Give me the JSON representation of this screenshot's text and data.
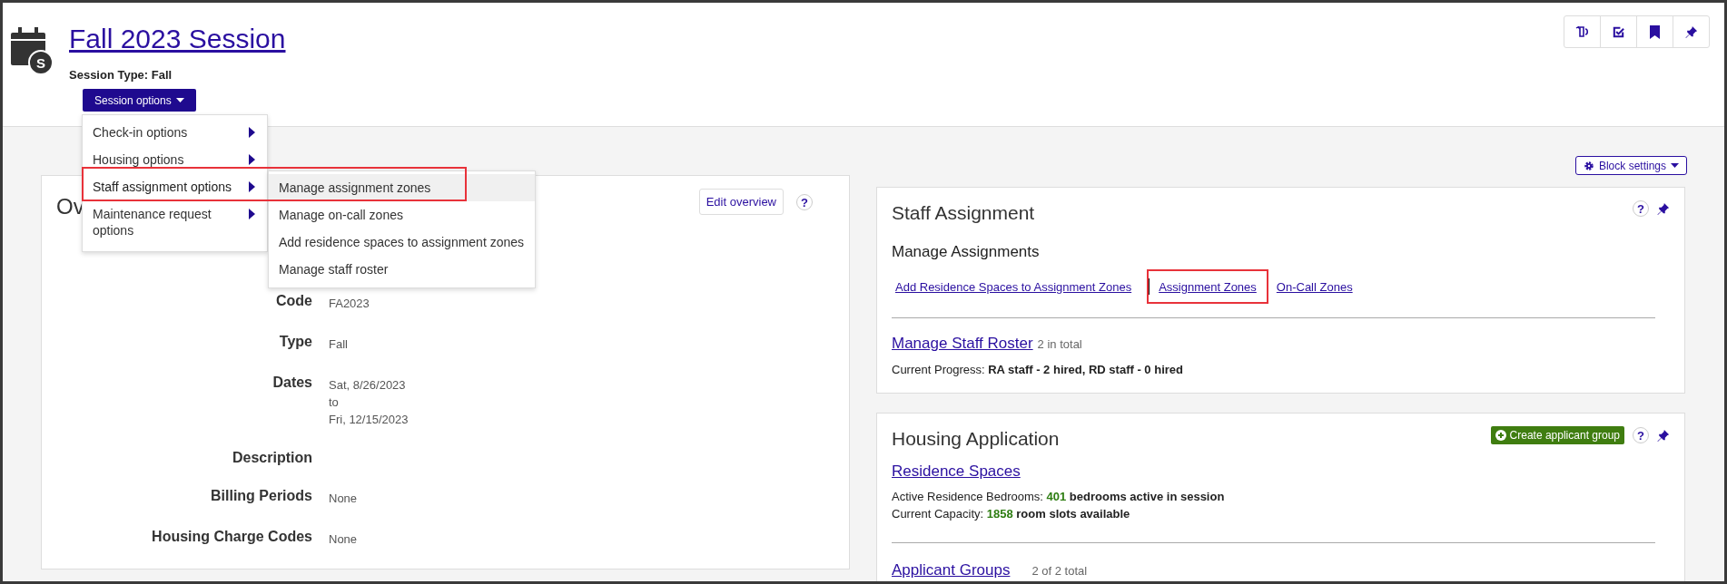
{
  "session": {
    "badge": "S",
    "title": "Fall 2023 Session",
    "type": "Session Type: Fall"
  },
  "session_options": {
    "label": "Session options",
    "expanded": true,
    "items": [
      {
        "label": "Check-in options",
        "selected": false
      },
      {
        "label": "Housing options",
        "selected": false
      },
      {
        "label": "Staff assignment options",
        "selected": true
      },
      {
        "label": "Maintenance request options",
        "selected": false
      }
    ],
    "submenu": [
      {
        "label": "Manage assignment zones",
        "selected": true,
        "highlighted": true
      },
      {
        "label": "Manage on-call zones",
        "selected": false,
        "highlighted": false
      },
      {
        "label": "Add residence spaces to assignment zones",
        "selected": false,
        "highlighted": false
      },
      {
        "label": "Manage staff roster",
        "selected": false,
        "highlighted": false
      }
    ]
  },
  "block_settings": "Block settings",
  "overview": {
    "title": "Ov",
    "edit_button": "Edit overview",
    "help": "?",
    "fields": [
      {
        "label": "Code",
        "values": [
          "FA2023"
        ]
      },
      {
        "label": "Type",
        "values": [
          "Fall"
        ]
      },
      {
        "label": "Dates",
        "values": [
          "Sat, 8/26/2023",
          "to",
          "Fri, 12/15/2023"
        ]
      },
      {
        "label": "Description"
      },
      {
        "label": "Billing Periods",
        "values": [
          "None"
        ]
      },
      {
        "label": "Housing Charge Codes",
        "values": [
          "None"
        ]
      }
    ]
  },
  "staff_assignment": {
    "title": "Staff Assignment",
    "help": "?",
    "section": "Manage Assignments",
    "links": [
      {
        "label": "Add Residence Spaces to Assignment Zones",
        "highlighted": false
      },
      {
        "label": "Assignment Zones",
        "highlighted": true
      },
      {
        "label": "On-Call Zones",
        "highlighted": false
      }
    ],
    "roster_link": "Manage Staff Roster",
    "roster_count": "2 in total",
    "progress": "Current Progress: **RA staff - 2 hired, RD staff - 0 hired**"
  },
  "housing_application": {
    "title": "Housing Application",
    "create_button": "Create applicant group",
    "help": "?",
    "spaces_link": "Residence Spaces",
    "stats": [
      {
        "label": "Active Residence Bedrooms:",
        "number": "401",
        "text": "bedrooms active in session"
      },
      {
        "label": "Current Capacity:",
        "number": "1858",
        "text": "room slots available"
      }
    ],
    "groups_link": "Applicant Groups",
    "groups_count": "2 of 2 total"
  }
}
